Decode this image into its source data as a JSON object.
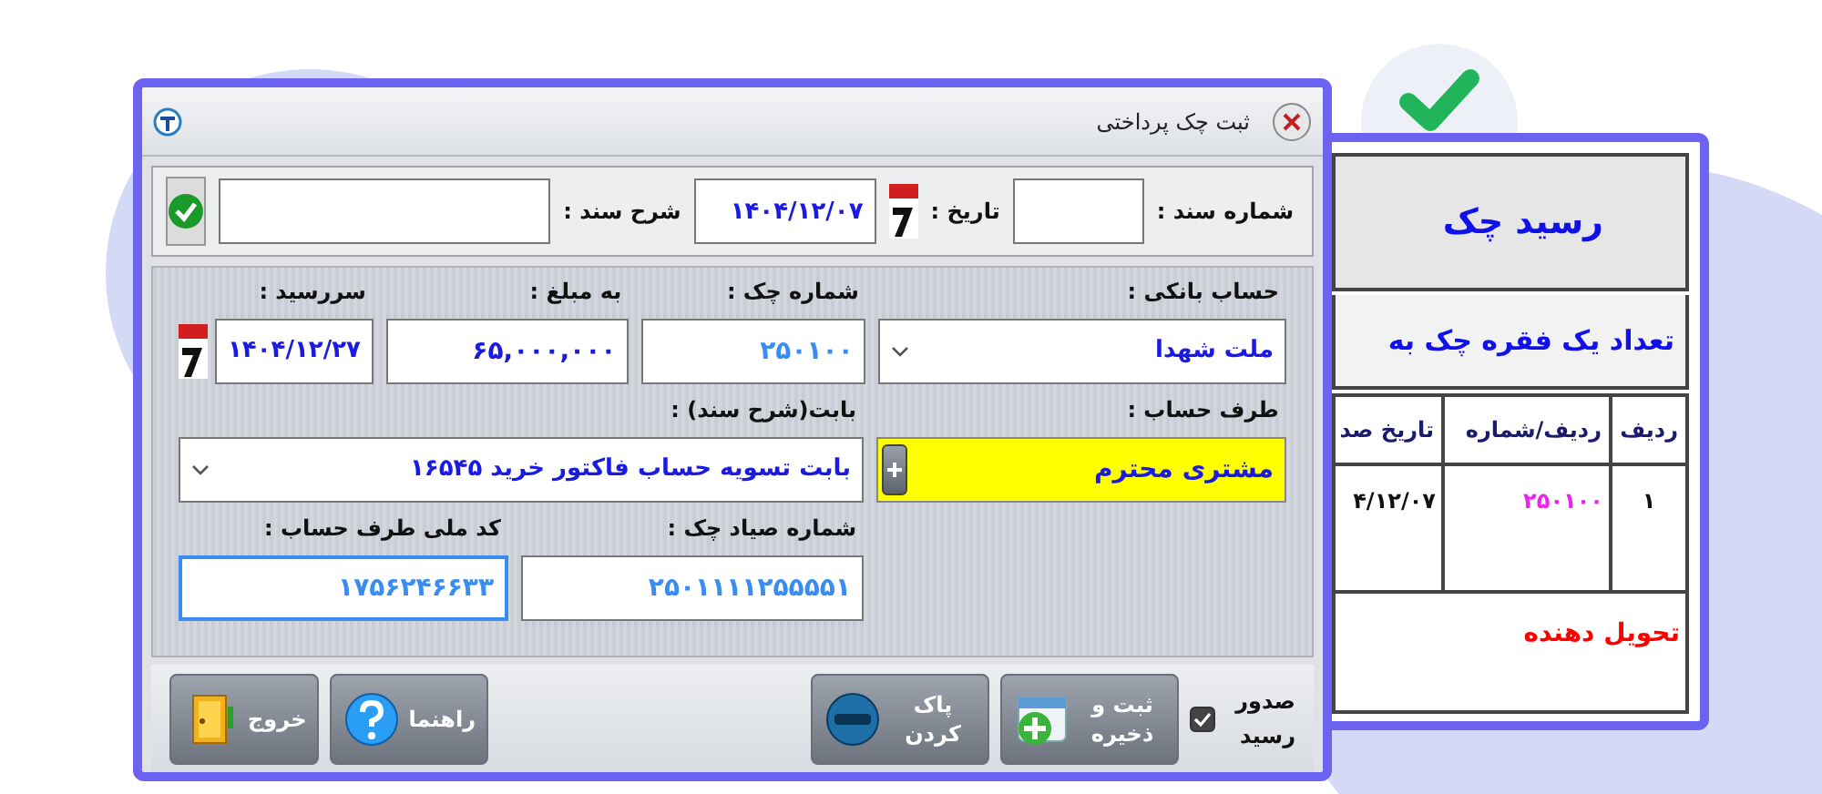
{
  "window": {
    "title": "ثبت چک پرداختی"
  },
  "document": {
    "number_label": "شماره سند :",
    "date_label": "تاریخ :",
    "date": "۱۴۰۴/۱۲/۰۷",
    "description_label": "شرح سند :"
  },
  "rows": [
    [
      {
        "kind": "dropdown",
        "label": "حساب بانکی :",
        "value": "ملت شهدا",
        "focused": false
      },
      {
        "kind": "number",
        "label": "شماره چک :",
        "value": "۲۵۰۱۰۰",
        "focused": false
      },
      {
        "kind": "amount",
        "label": "به مبلغ :",
        "value": "۶۵,۰۰۰,۰۰۰",
        "focused": false
      },
      {
        "kind": "date",
        "label": "سررسید :",
        "value": "۱۴۰۴/۱۲/۲۷",
        "focused": false
      }
    ],
    [
      {
        "kind": "account",
        "label": "طرف حساب :",
        "value": "مشتری محترم",
        "focused": false
      },
      {
        "kind": "dropdown",
        "label": "بابت(شرح سند) :",
        "value": "بابت تسویه حساب فاکتور خرید ۱۶۵۴۵",
        "focused": false
      }
    ],
    [
      {
        "kind": "number",
        "label": "شماره صیاد چک :",
        "value": "۲۵۰۱۱۱۱۲۵۵۵۵۱",
        "focused": false
      },
      {
        "kind": "number",
        "label": "کد ملی طرف حساب :",
        "value": "۱۷۵۶۲۴۶۶۳۳",
        "focused": true
      }
    ]
  ],
  "receipt_checkbox": {
    "label": "صدور رسید",
    "checked": true
  },
  "actions": [
    {
      "kind": "save",
      "label": "ثبت و ذخیره"
    },
    {
      "kind": "clear",
      "label": "پاک کردن"
    }
  ],
  "side_actions": [
    {
      "kind": "help",
      "label": "راهنما"
    },
    {
      "kind": "exit",
      "label": "خروج"
    }
  ],
  "receipt": {
    "title": "رسید چک",
    "summary": "تعداد  یک  فقره چک به",
    "columns": [
      "ردیف",
      "ردیف/شماره",
      "تاریخ صد"
    ],
    "rows": [
      [
        "۱",
        "۲۵۰۱۰۰",
        "۴/۱۲/۰۷"
      ]
    ],
    "footer": "تحویل دهنده"
  }
}
